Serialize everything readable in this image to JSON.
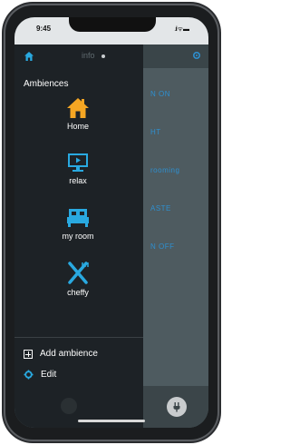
{
  "status_bar": {
    "time": "9:45",
    "signal": ".ıl ᯤ ▬"
  },
  "drawer": {
    "info_label": "info",
    "section_title": "Ambiences",
    "ambiences": [
      {
        "label": "Home",
        "icon": "house-icon"
      },
      {
        "label": "relax",
        "icon": "tv-icon"
      },
      {
        "label": "my room",
        "icon": "bed-icon"
      },
      {
        "label": "cheffy",
        "icon": "kitchen-utensils-icon"
      }
    ],
    "add_label": "Add ambience",
    "edit_label": "Edit"
  },
  "background_items": [
    "N ON",
    "HT",
    "rooming",
    "ASTE",
    "N OFF"
  ],
  "colors": {
    "accent_orange": "#f5a623",
    "accent_blue": "#29a9e0",
    "drawer_bg": "#1d2226"
  }
}
